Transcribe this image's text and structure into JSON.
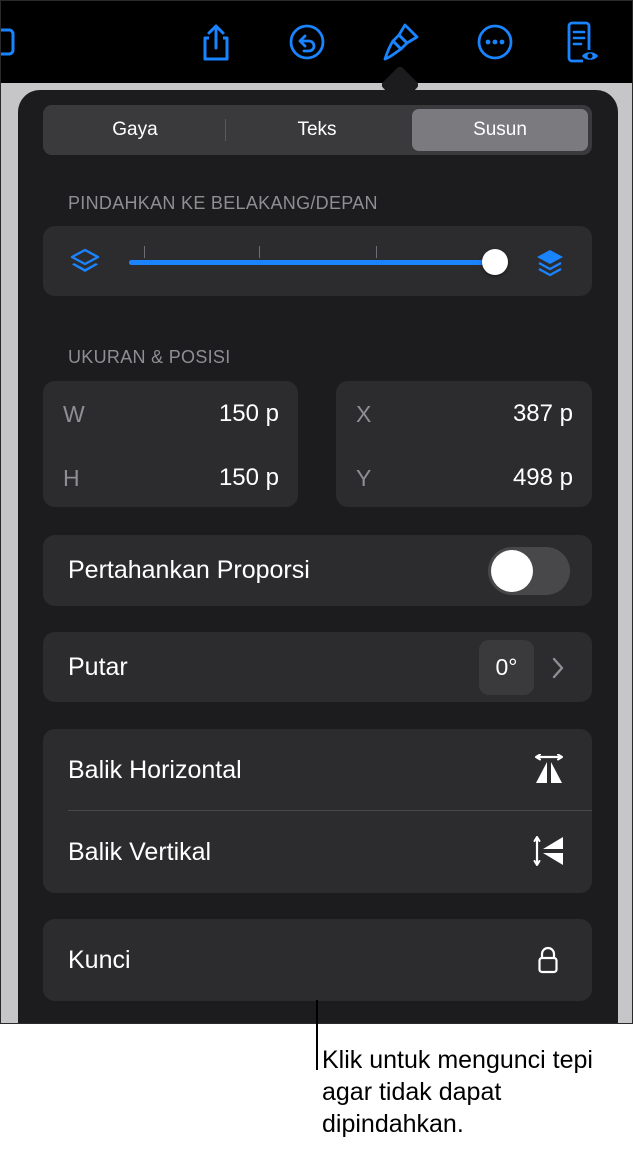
{
  "toolbar": {
    "icons": [
      "document-edge-icon",
      "share-icon",
      "undo-icon",
      "paintbrush-icon",
      "more-icon",
      "reading-view-icon"
    ]
  },
  "tabs": [
    {
      "label": "Gaya",
      "active": false
    },
    {
      "label": "Teks",
      "active": false
    },
    {
      "label": "Susun",
      "active": true
    }
  ],
  "arrange": {
    "move_label": "PINDAHKAN KE BELAKANG/DEPAN",
    "slider_fraction": 1.0,
    "size_label": "UKURAN & POSISI",
    "size": {
      "w_label": "W",
      "w_value": "150 p",
      "h_label": "H",
      "h_value": "150 p"
    },
    "position": {
      "x_label": "X",
      "x_value": "387 p",
      "y_label": "Y",
      "y_value": "498 p"
    },
    "constrain_label": "Pertahankan Proporsi",
    "constrain_on": false,
    "rotate_label": "Putar",
    "rotate_value": "0°",
    "flip_h_label": "Balik Horizontal",
    "flip_v_label": "Balik Vertikal",
    "lock_label": "Kunci"
  },
  "callout": "Klik untuk mengunci tepi agar tidak dapat dipindahkan.",
  "colors": {
    "accent": "#1a84ff",
    "panel": "#1c1c1e",
    "card": "#2c2c2e"
  }
}
